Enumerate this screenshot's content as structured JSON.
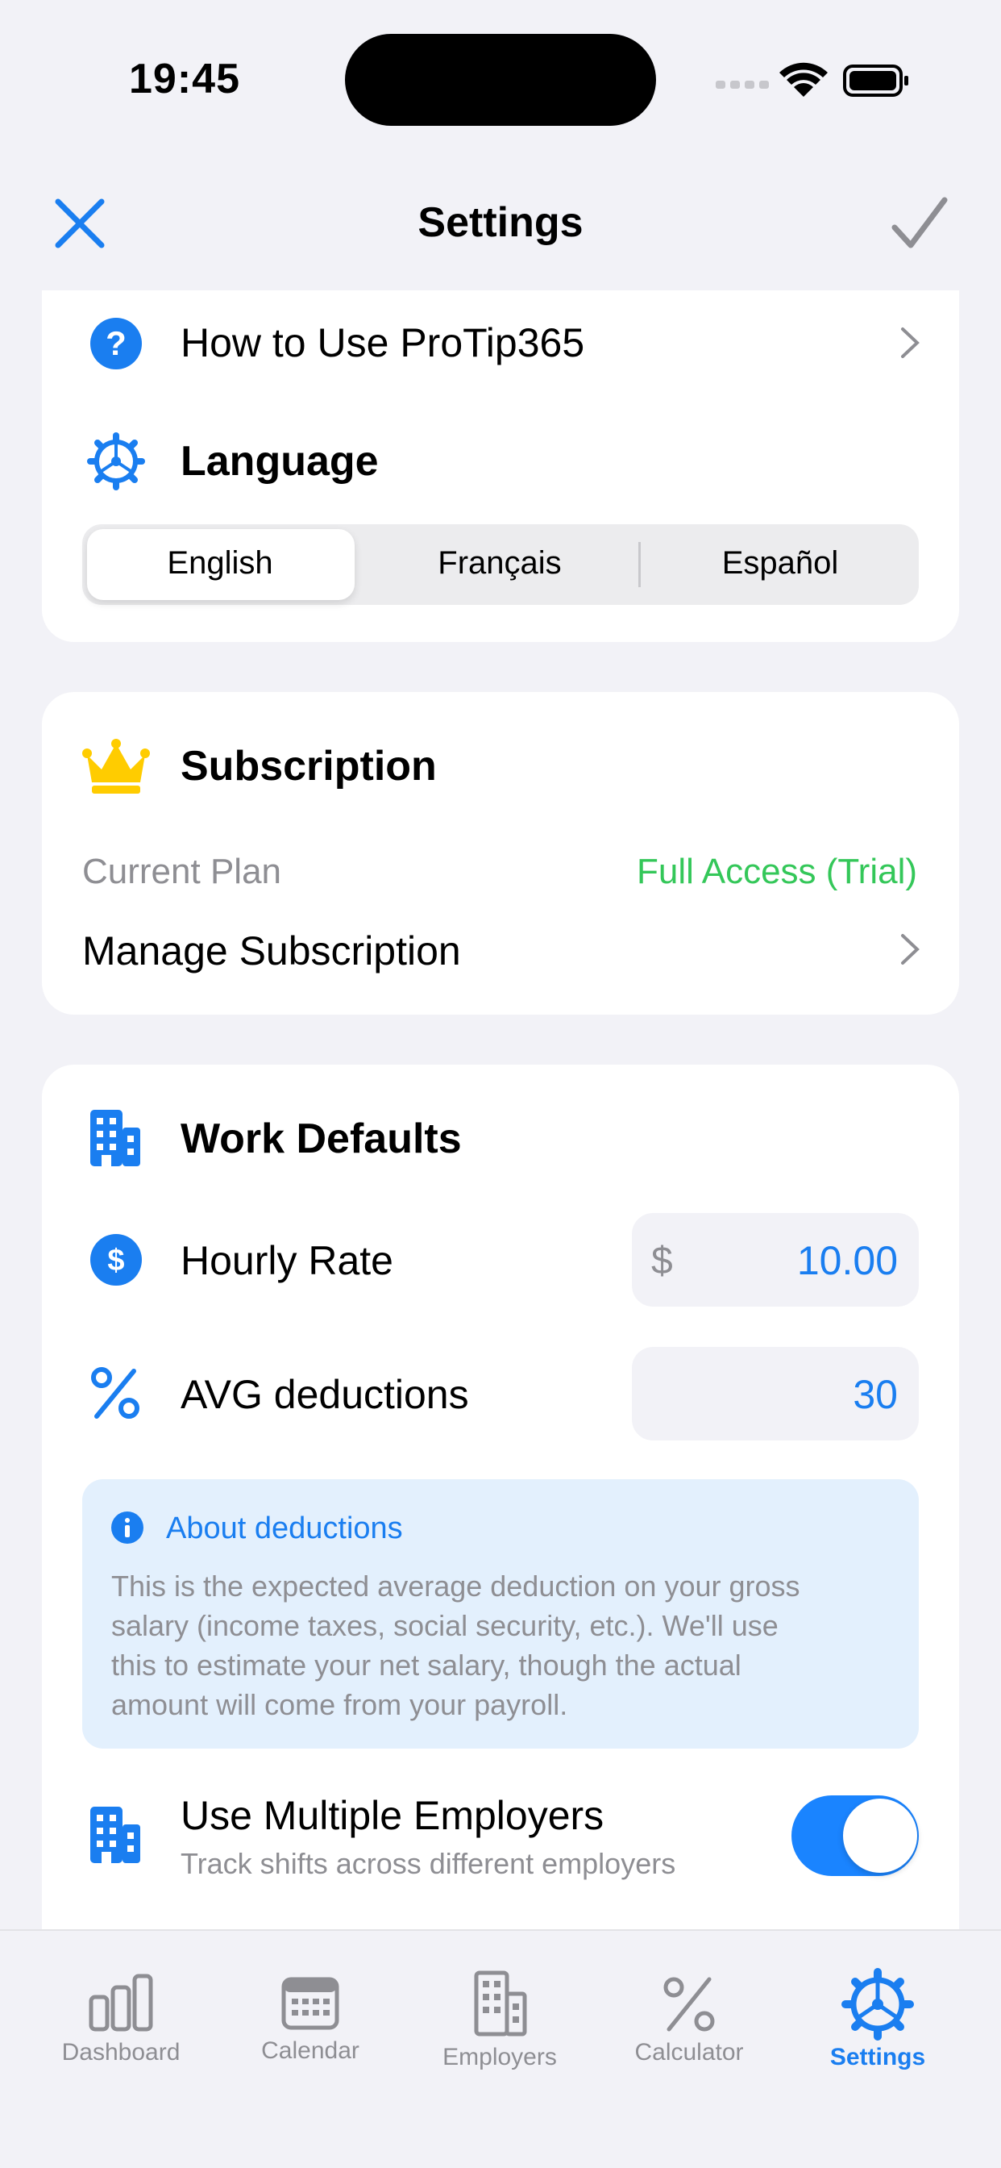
{
  "status_bar": {
    "time": "19:45"
  },
  "nav": {
    "title": "Settings"
  },
  "help": {
    "label": "How to Use ProTip365"
  },
  "language": {
    "title": "Language",
    "options": [
      "English",
      "Français",
      "Español"
    ],
    "selected": "English"
  },
  "subscription": {
    "title": "Subscription",
    "current_plan_label": "Current Plan",
    "current_plan_value": "Full Access (Trial)",
    "manage_label": "Manage Subscription"
  },
  "work_defaults": {
    "title": "Work Defaults",
    "hourly_rate_label": "Hourly Rate",
    "currency_symbol": "$",
    "hourly_rate_value": "10.00",
    "deductions_label": "AVG deductions",
    "deductions_value": "30",
    "about_title": "About deductions",
    "about_lines": [
      "This is the expected average deduction on your gross",
      "salary (income taxes, social security, etc.). We'll use",
      "this to estimate your net salary, though the actual",
      "amount will come from your payroll."
    ],
    "multiple_employers_label": "Use Multiple Employers",
    "multiple_employers_subtitle": "Track shifts across different employers",
    "multiple_employers_enabled": true
  },
  "tab_bar": {
    "tabs": [
      "Dashboard",
      "Calendar",
      "Employers",
      "Calculator",
      "Settings"
    ],
    "active": "Settings"
  },
  "colors": {
    "accent": "#1a7ef0",
    "green": "#34c759",
    "crown": "#ffcc00",
    "secondary_text": "#8e8e93"
  }
}
